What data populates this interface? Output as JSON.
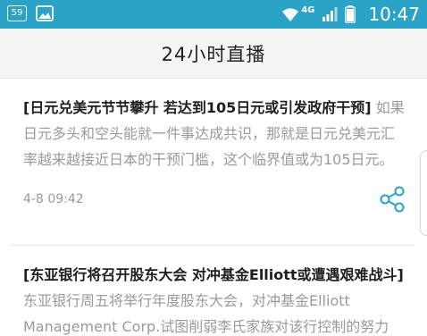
{
  "status_bar": {
    "notification_count": "59",
    "network": "4G",
    "time": "10:47",
    "icons": [
      "gallery-icon",
      "wifi-icon",
      "signal-icon",
      "battery-icon"
    ]
  },
  "header": {
    "title": "24小时直播"
  },
  "feed": {
    "items": [
      {
        "headline": "[日元兑美元节节攀升 若达到105日元或引发政府干预]",
        "summary": " 如果日元多头和空头能就一件事达成共识，那就是日元兑美元汇率越来越接近日本的干预门槛，这个临界值或为105日元。",
        "timestamp": "4-8 09:42",
        "share_icon": "share-icon"
      },
      {
        "headline": "[东亚银行将召开股东大会 对冲基金Elliott或遭遇艰难战斗]",
        "summary": " 东亚银行周五将举行年度股东大会，对冲基金Elliott Management Corp.试图削弱李氏家族对该行控制的努力"
      }
    ]
  },
  "colors": {
    "status_bar_bg": "#2aa3c7",
    "header_bg": "#f4f4f4",
    "share_icon": "#2aa3c7"
  }
}
